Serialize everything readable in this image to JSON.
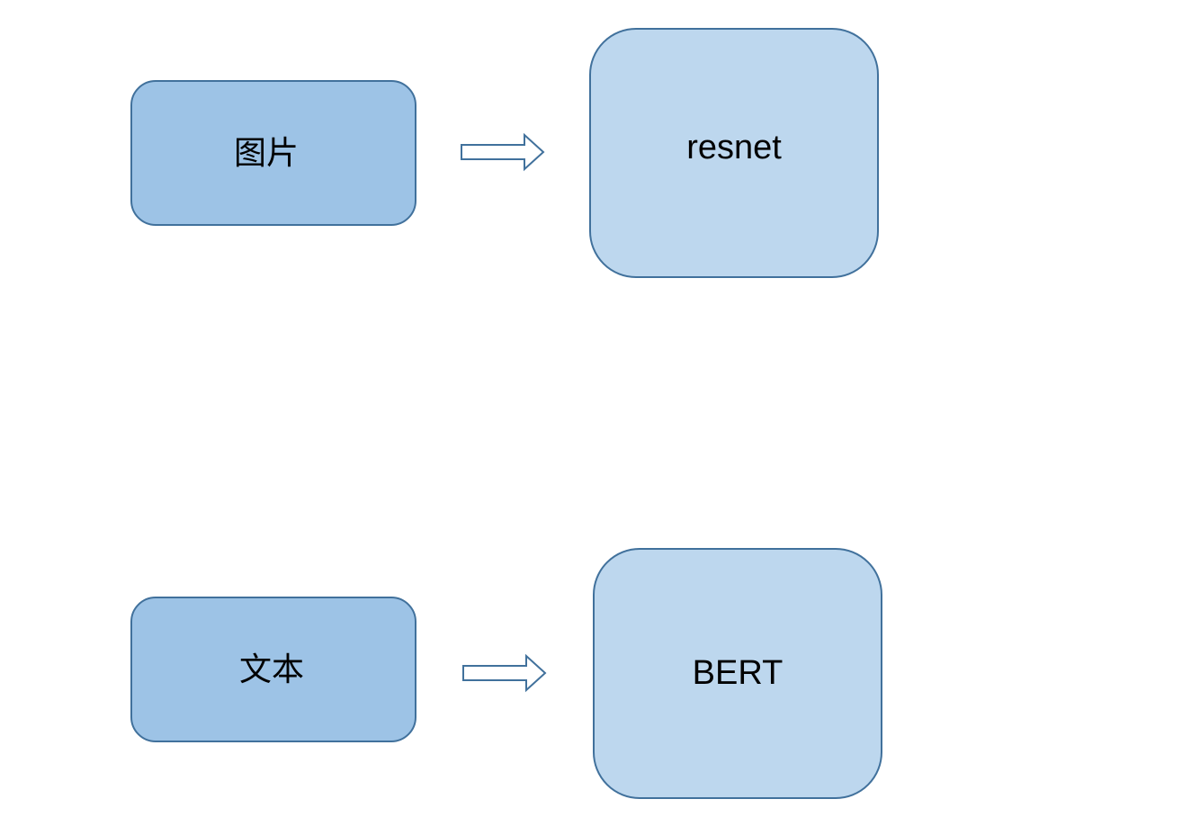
{
  "diagram": {
    "rows": [
      {
        "input_label": "图片",
        "model_label": "resnet"
      },
      {
        "input_label": "文本",
        "model_label": "BERT"
      }
    ],
    "colors": {
      "input_fill": "#9dc3e6",
      "model_fill": "#bdd7ee",
      "stroke": "#41719c"
    }
  }
}
